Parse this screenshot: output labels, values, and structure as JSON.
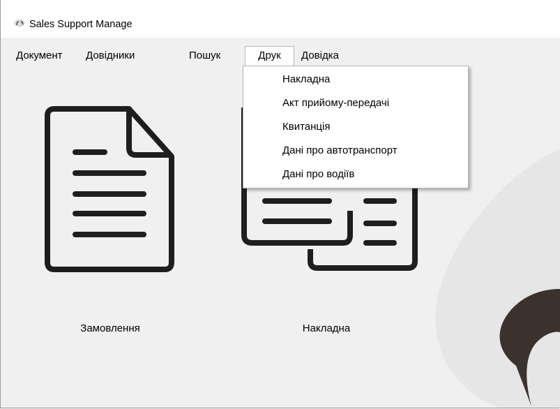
{
  "window": {
    "title": "Sales Support Manage",
    "icon": "app-logo-icon"
  },
  "menu": {
    "items": [
      "Документ",
      "Довідники",
      "Пошук",
      "Друк",
      "Довідка"
    ],
    "active_index": 3
  },
  "dropdown": {
    "items": [
      "Накладна",
      "Акт прийому-передачі",
      "Квитанція",
      "Дані про автотранспорт",
      "Дані про водіїв"
    ]
  },
  "tiles": [
    {
      "label": "Замовлення",
      "icon": "document-icon"
    },
    {
      "label": "Накладна",
      "icon": "documents-stack-icon"
    }
  ],
  "colors": {
    "background": "#f0f0f0",
    "blob": "#e6e6e6",
    "logo_mark": "#3b322d",
    "icon_stroke": "#1e1e1e"
  }
}
